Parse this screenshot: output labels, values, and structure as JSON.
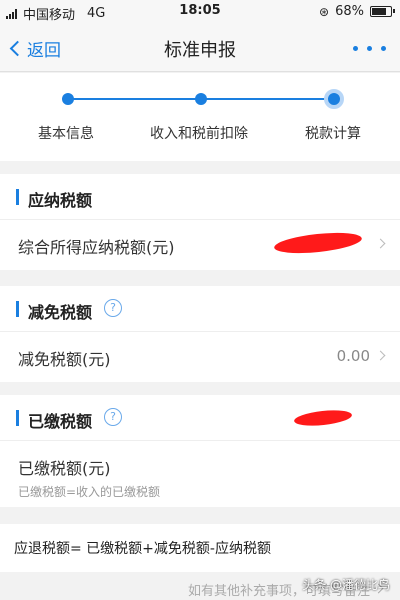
{
  "status_bar": {
    "carrier": "中国移动",
    "network": "4G",
    "time": "18:05",
    "battery": "68%",
    "battery_level": 0.68
  },
  "nav": {
    "back_label": "返回",
    "title": "标准申报"
  },
  "steps": {
    "items": [
      {
        "label": "基本信息"
      },
      {
        "label": "收入和税前扣除"
      },
      {
        "label": "税款计算"
      }
    ],
    "active_index": 2
  },
  "payable": {
    "title": "应纳税额",
    "row_label": "综合所得应纳税额(元)"
  },
  "reduction": {
    "title": "减免税额",
    "row_label": "减免税额(元)",
    "row_value": "0.00"
  },
  "paid": {
    "title": "已缴税额",
    "row_label": "已缴税额(元)",
    "hint": "已缴税额=收入的已缴税额"
  },
  "formula": {
    "text": "应退税额= 已缴税额+减免税额-应纳税额"
  },
  "footer": {
    "note": "如有其他补充事项，可填写备注",
    "watermark": "头条 @潘德比鸟"
  },
  "colors": {
    "accent": "#1a7fe0",
    "redaction": "#ff1a1a"
  }
}
